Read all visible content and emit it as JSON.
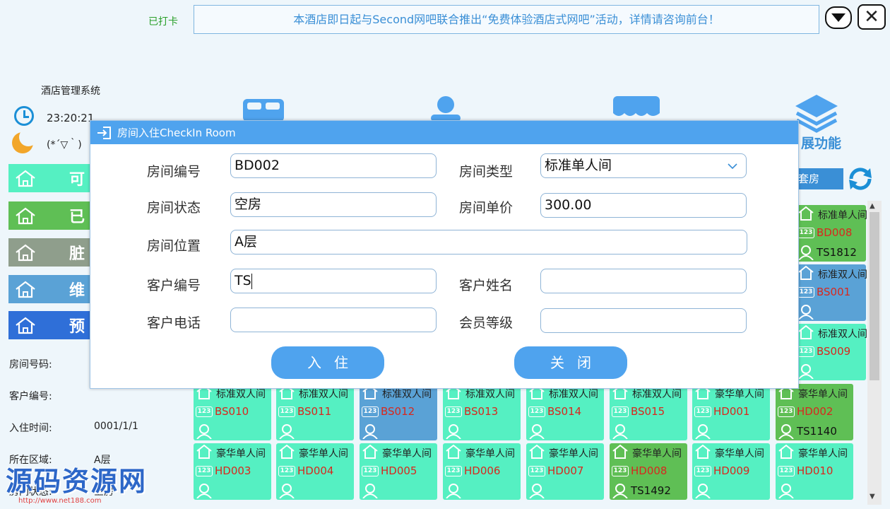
{
  "header": {
    "checkin_status": "已打卡",
    "marquee": "本酒店即日起与Second网吧联合推出“免费体验酒店式网吧”活动，详情请咨询前台！"
  },
  "sidebar": {
    "system_title": "酒店管理系统",
    "clock_time": "23:20:21",
    "moon_text": "(*´▽｀)",
    "status_buttons": [
      {
        "label": "可",
        "color": "#55f0c2"
      },
      {
        "label": "已",
        "color": "#5fbf55"
      },
      {
        "label": "脏",
        "color": "#8f9e8c"
      },
      {
        "label": "维",
        "color": "#5aa2d6"
      },
      {
        "label": "预",
        "color": "#2f6fd8"
      }
    ],
    "info": {
      "room_no_label": "房间号码:",
      "customer_no_label": "客户编号:",
      "checkin_time_label": "入住时间:",
      "checkin_time_value": "0001/1/1",
      "area_label": "所在区域:",
      "area_value": "A层",
      "room_status_label": "房间状态:",
      "room_status_value": "空房"
    }
  },
  "toolbar": {
    "extension_label": "展功能",
    "suite_button": "套房"
  },
  "rooms": [
    {
      "type": "标准单人间",
      "number": "BD008",
      "customer": "TS1812",
      "color": "#5fbf55"
    },
    {
      "type": "标准双人间",
      "number": "BS001",
      "customer": "",
      "color": "#5aa2d6"
    },
    {
      "type": "标准双人间",
      "number": "BS009",
      "customer": "",
      "color": "#55f0c2"
    },
    {
      "type": "标准双人间",
      "number": "BS010",
      "customer": "",
      "color": "#55f0c2"
    },
    {
      "type": "标准双人间",
      "number": "BS011",
      "customer": "",
      "color": "#55f0c2"
    },
    {
      "type": "标准双人间",
      "number": "BS012",
      "customer": "",
      "color": "#5aa2d6"
    },
    {
      "type": "标准双人间",
      "number": "BS013",
      "customer": "",
      "color": "#55f0c2"
    },
    {
      "type": "标准双人间",
      "number": "BS014",
      "customer": "",
      "color": "#55f0c2"
    },
    {
      "type": "标准双人间",
      "number": "BS015",
      "customer": "",
      "color": "#55f0c2"
    },
    {
      "type": "豪华单人间",
      "number": "HD001",
      "customer": "",
      "color": "#55f0c2"
    },
    {
      "type": "豪华单人间",
      "number": "HD002",
      "customer": "TS1140",
      "color": "#5fbf55"
    },
    {
      "type": "豪华单人间",
      "number": "HD003",
      "customer": "",
      "color": "#55f0c2"
    },
    {
      "type": "豪华单人间",
      "number": "HD004",
      "customer": "",
      "color": "#55f0c2"
    },
    {
      "type": "豪华单人间",
      "number": "HD005",
      "customer": "",
      "color": "#55f0c2"
    },
    {
      "type": "豪华单人间",
      "number": "HD006",
      "customer": "",
      "color": "#55f0c2"
    },
    {
      "type": "豪华单人间",
      "number": "HD007",
      "customer": "",
      "color": "#55f0c2"
    },
    {
      "type": "豪华单人间",
      "number": "HD008",
      "customer": "TS1492",
      "color": "#5fbf55"
    },
    {
      "type": "豪华单人间",
      "number": "HD009",
      "customer": "",
      "color": "#55f0c2"
    },
    {
      "type": "豪华单人间",
      "number": "HD010",
      "customer": "",
      "color": "#55f0c2"
    }
  ],
  "dialog": {
    "title": "房间入住CheckIn Room",
    "room_no_label": "房间编号",
    "room_no_value": "BD002",
    "room_type_label": "房间类型",
    "room_type_value": "标准单人间",
    "room_status_label": "房间状态",
    "room_status_value": "空房",
    "room_price_label": "房间单价",
    "room_price_value": "300.00",
    "room_location_label": "房间位置",
    "room_location_value": "A层",
    "customer_no_label": "客户编号",
    "customer_no_value": "TS",
    "customer_name_label": "客户姓名",
    "customer_name_value": "",
    "customer_phone_label": "客户电话",
    "customer_phone_value": "",
    "member_level_label": "会员等级",
    "member_level_value": "",
    "checkin_button": "入住",
    "close_button": "关闭"
  },
  "watermark": {
    "text": "源码资源网",
    "url": "http://www.net188.com"
  }
}
